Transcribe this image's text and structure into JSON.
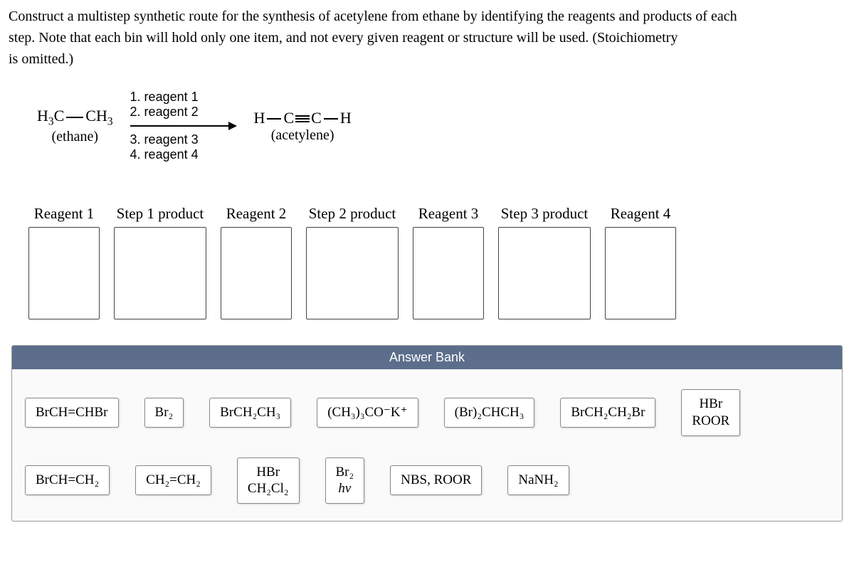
{
  "question": {
    "line1": "Construct a multistep synthetic route for the synthesis of acetylene from ethane by identifying the reagents and products of each",
    "line2": "step. Note that each bin will hold only one item, and not every given reagent or structure will be used. (Stoichiometry",
    "line3": "is omitted.)"
  },
  "scheme": {
    "start_formula_prefix": "H",
    "start_formula_sub1": "3",
    "start_formula_c": "C",
    "start_formula_ch": "CH",
    "start_formula_sub2": "3",
    "start_label": "(ethane)",
    "r1": "1. reagent 1",
    "r2": "2. reagent 2",
    "r3": "3. reagent 3",
    "r4": "4. reagent 4",
    "prod_h1": "H",
    "prod_c1": "C",
    "prod_c2": "C",
    "prod_h2": "H",
    "prod_label": "(acetylene)"
  },
  "drops": [
    {
      "label": "Reagent 1",
      "narrow": true
    },
    {
      "label": "Step 1 product",
      "narrow": false
    },
    {
      "label": "Reagent 2",
      "narrow": true
    },
    {
      "label": "Step 2 product",
      "narrow": false
    },
    {
      "label": "Reagent 3",
      "narrow": true
    },
    {
      "label": "Step 3 product",
      "narrow": false
    },
    {
      "label": "Reagent 4",
      "narrow": true
    }
  ],
  "bank": {
    "header": "Answer Bank",
    "tiles": {
      "t1": "BrCH=CHBr",
      "t2": "Br₂",
      "t3": "BrCH₂CH₃",
      "t4": "(CH₃)₃CO⁻K⁺",
      "t5": "(Br)₂CHCH₃",
      "t6": "BrCH₂CH₂Br",
      "t7a": "HBr",
      "t7b": "ROOR",
      "t8": "BrCH=CH₂",
      "t9": "CH₂=CH₂",
      "t10a": "HBr",
      "t10b": "CH₂Cl₂",
      "t11a": "Br₂",
      "t11b": "hv",
      "t12": "NBS, ROOR",
      "t13": "NaNH₂"
    }
  }
}
